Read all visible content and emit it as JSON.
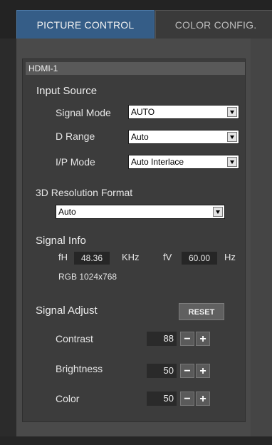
{
  "tabs": [
    {
      "label": "PICTURE CONTROL",
      "active": true
    },
    {
      "label": "COLOR CONFIG.",
      "active": false
    }
  ],
  "input_label": "HDMI-1",
  "input_source": {
    "title": "Input Source",
    "signal_mode": {
      "label": "Signal Mode",
      "value": "AUTO"
    },
    "d_range": {
      "label": "D Range",
      "value": "Auto"
    },
    "ip_mode": {
      "label": "I/P Mode",
      "value": "Auto Interlace"
    }
  },
  "resolution_3d": {
    "title": "3D Resolution Format",
    "value": "Auto"
  },
  "signal_info": {
    "title": "Signal Info",
    "fh_label": "fH",
    "fh_value": "48.36",
    "fh_unit": "KHz",
    "fv_label": "fV",
    "fv_value": "60.00",
    "fv_unit": "Hz",
    "resolution": "RGB 1024x768"
  },
  "signal_adjust": {
    "title": "Signal Adjust",
    "reset_label": "RESET",
    "items": [
      {
        "label": "Contrast",
        "value": "88"
      },
      {
        "label": "Brightness",
        "value": "50"
      },
      {
        "label": "Color",
        "value": "50"
      }
    ],
    "minus": "−",
    "plus": "+"
  },
  "colors": {
    "active_tab": "#355d87",
    "panel": "#4a4a4a",
    "inner": "#3c3c3c"
  }
}
